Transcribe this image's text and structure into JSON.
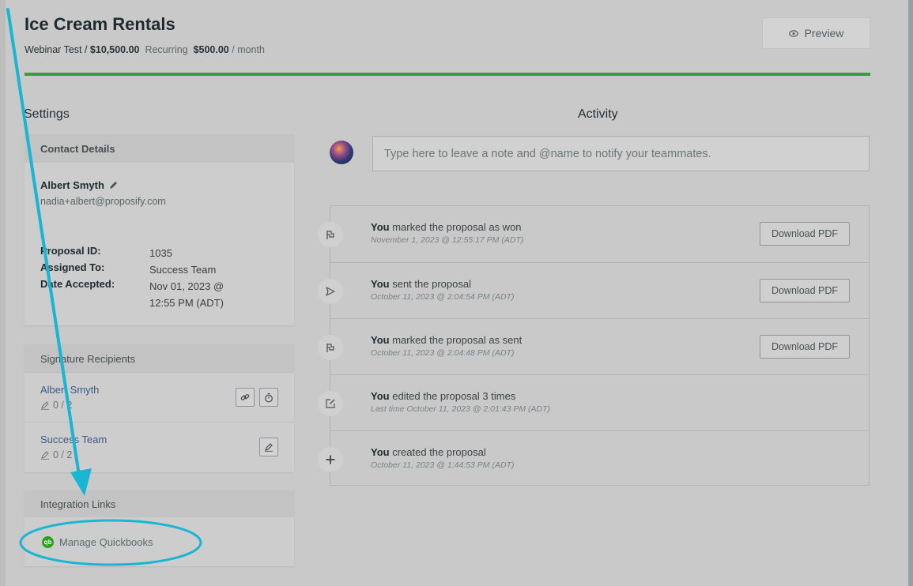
{
  "header": {
    "title": "Ice Cream Rentals",
    "breadcrumb": "Webinar Test /",
    "amount": "$10,500.00",
    "recurring_label": "Recurring",
    "recurring_amount": "$500.00",
    "recurring_period": "/ month",
    "preview_label": "Preview",
    "progress": 1.0
  },
  "settings_heading": "Settings",
  "activity_heading": "Activity",
  "contact": {
    "heading": "Contact Details",
    "name": "Albert Smyth",
    "email": "nadia+albert@proposify.com",
    "fields": [
      {
        "label": "Proposal ID:",
        "value": "1035"
      },
      {
        "label": "Assigned To:",
        "value": "Success Team"
      },
      {
        "label": "Date Accepted:",
        "value": "Nov 01, 2023 @ 12:55 PM (ADT)"
      }
    ]
  },
  "recipients": {
    "heading": "Signature Recipients",
    "items": [
      {
        "name": "Albert Smyth",
        "count": "0 / 2"
      },
      {
        "name": "Success Team",
        "count": "0 / 2"
      }
    ]
  },
  "integration": {
    "heading": "Integration Links",
    "icon_text": "qb",
    "link_label": "Manage Quickbooks"
  },
  "note": {
    "placeholder": "Type here to leave a note and @name to notify your teammates."
  },
  "activity": [
    {
      "icon": "flag-icon",
      "actor": "You",
      "text": "marked the proposal as won",
      "time": "November 1, 2023 @ 12:55:17 PM (ADT)",
      "button": "Download PDF"
    },
    {
      "icon": "send-icon",
      "actor": "You",
      "text": "sent the proposal",
      "time": "October 11, 2023 @ 2:04:54 PM (ADT)",
      "button": "Download PDF"
    },
    {
      "icon": "flag-icon",
      "actor": "You",
      "text": "marked the proposal as sent",
      "time": "October 11, 2023 @ 2:04:48 PM (ADT)",
      "button": "Download PDF"
    },
    {
      "icon": "edit-icon",
      "actor": "You",
      "text": "edited the proposal 3 times",
      "time": "Last time October 11, 2023 @ 2:01:43 PM (ADT)",
      "button": ""
    },
    {
      "icon": "plus-icon",
      "actor": "You",
      "text": "created the proposal",
      "time": "October 11, 2023 @ 1:44:53 PM (ADT)",
      "button": ""
    }
  ],
  "colors": {
    "progress": "#3c9a41",
    "annotation": "#19b5d3",
    "link": "#3b5a8a",
    "quickbooks": "#2ca01c"
  }
}
